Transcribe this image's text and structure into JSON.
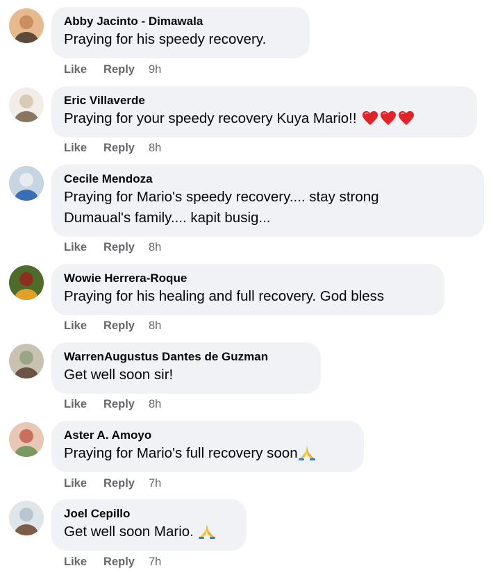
{
  "comments": [
    {
      "author": "Abby Jacinto - Dimawala",
      "lines": [
        "Praying for his speedy recovery."
      ],
      "emoji": "",
      "like": "Like",
      "reply": "Reply",
      "time": "9h",
      "avatar_colors": [
        "#c98f63",
        "#5c4a3b",
        "#e7b98f"
      ]
    },
    {
      "author": "Eric Villaverde",
      "lines": [
        "Praying for your speedy recovery Kuya Mario!!"
      ],
      "emoji": "hearts-3",
      "like": "Like",
      "reply": "Reply",
      "time": "8h",
      "avatar_colors": [
        "#d9cbb8",
        "#8a7660",
        "#f2ede6"
      ]
    },
    {
      "author": "Cecile Mendoza",
      "lines": [
        "Praying for Mario's speedy recovery.... stay strong",
        "Dumaual's family.... kapit busig..."
      ],
      "emoji": "",
      "like": "Like",
      "reply": "Reply",
      "time": "8h",
      "avatar_colors": [
        "#e8ecef",
        "#3a6fb5",
        "#c7d4e2"
      ]
    },
    {
      "author": "Wowie Herrera-Roque",
      "lines": [
        "Praying for his healing and full recovery. God bless"
      ],
      "emoji": "",
      "like": "Like",
      "reply": "Reply",
      "time": "8h",
      "avatar_colors": [
        "#8c2f1e",
        "#e0a12a",
        "#4d6b2a"
      ]
    },
    {
      "author": "WarrenAugustus Dantes de Guzman",
      "lines": [
        "Get well soon sir!"
      ],
      "emoji": "",
      "like": "Like",
      "reply": "Reply",
      "time": "8h",
      "avatar_colors": [
        "#9aa586",
        "#6b5446",
        "#c9c2b2"
      ]
    },
    {
      "author": "Aster A. Amoyo",
      "lines": [
        "Praying for Mario's full recovery soon"
      ],
      "emoji": "pray",
      "like": "Like",
      "reply": "Reply",
      "time": "7h",
      "avatar_colors": [
        "#c96f5e",
        "#7a9a62",
        "#e8c7b5"
      ]
    },
    {
      "author": "Joel Cepillo",
      "lines": [
        "Get well soon Mario."
      ],
      "emoji": "pray",
      "like": "Like",
      "reply": "Reply",
      "time": "7h",
      "avatar_colors": [
        "#b7c6cf",
        "#7c5d47",
        "#dfe5e8"
      ]
    }
  ]
}
